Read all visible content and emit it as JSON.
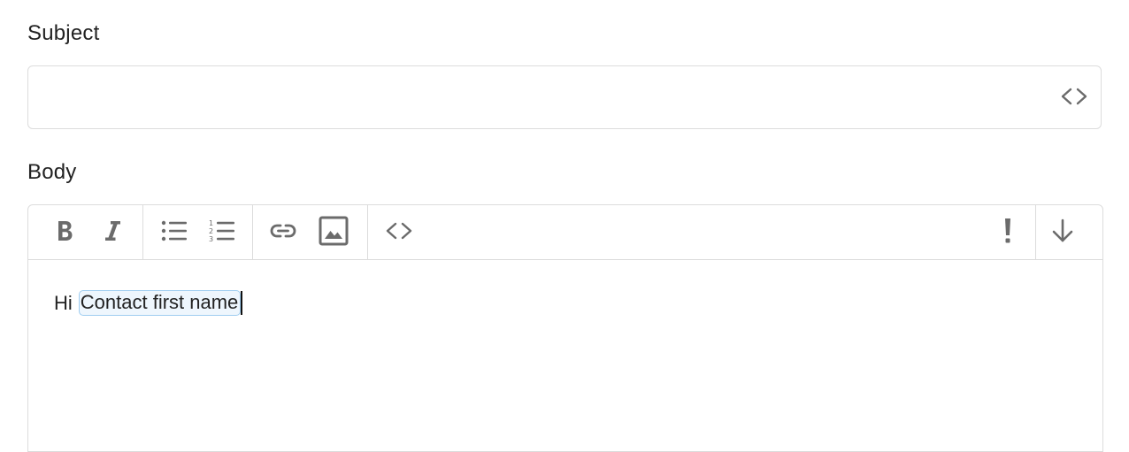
{
  "subject": {
    "label": "Subject",
    "value": "",
    "placeholder": "",
    "insert_variable_icon": "code-brackets-icon"
  },
  "body": {
    "label": "Body",
    "toolbar": {
      "bold": "bold-icon",
      "italic": "italic-icon",
      "bullet_list": "bulleted-list-icon",
      "numbered_list": "numbered-list-icon",
      "link": "link-icon",
      "image": "image-icon",
      "code": "code-brackets-icon",
      "important": "exclamation-icon",
      "expand": "arrow-down-icon"
    },
    "content": {
      "greeting": "Hi",
      "variable": "Contact first name"
    }
  },
  "colors": {
    "border": "#dcdcdc",
    "icon": "#6b6b6b",
    "chip_border": "#9fcdf0",
    "chip_bg": "#eef6fd"
  }
}
